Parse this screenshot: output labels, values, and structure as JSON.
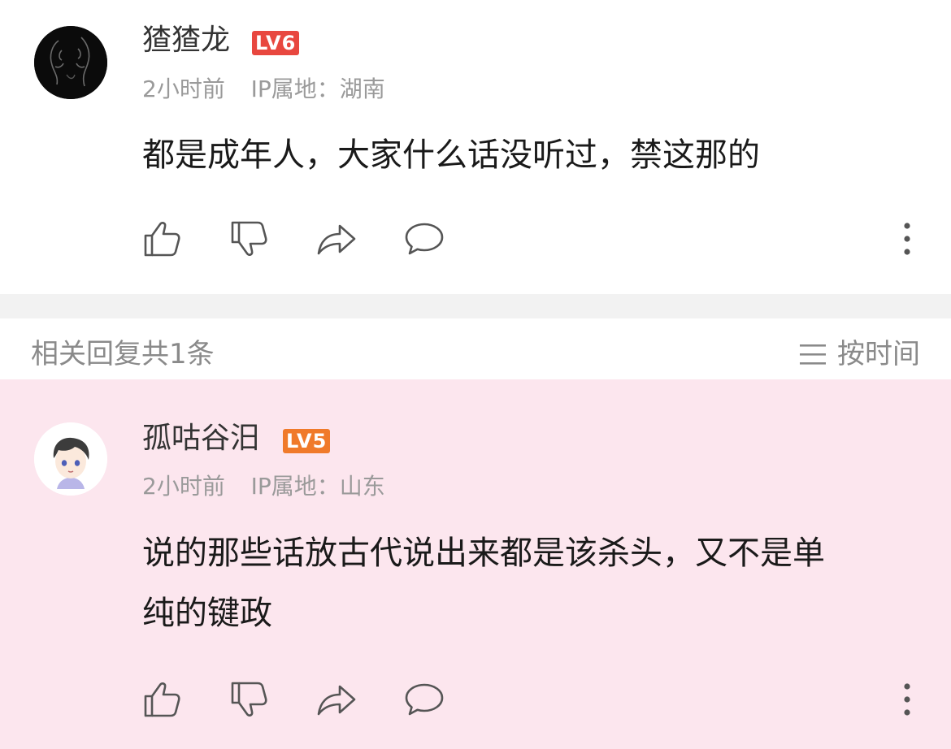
{
  "comment": {
    "username": "猹猹龙",
    "level": "LV6",
    "level_color": "#e8473f",
    "time": "2小时前",
    "ip_label": "IP属地：",
    "location": "湖南",
    "text": "都是成年人，大家什么话没听过，禁这那的",
    "avatar_icon": "dark-portrait-avatar",
    "actions": [
      "thumbs-up-icon",
      "thumbs-down-icon",
      "share-icon",
      "reply-bubble-icon",
      "more-vertical-icon"
    ]
  },
  "replies_header": {
    "count_text": "相关回复共1条",
    "sort_label": "按时间",
    "sort_icon": "menu-lines-icon"
  },
  "reply": {
    "username": "孤咕谷汨",
    "level": "LV5",
    "level_color": "#f07a2a",
    "time": "2小时前",
    "ip_label": "IP属地：",
    "location": "山东",
    "text_line1": "说的那些话放古代说出来都是该杀头，又不是单",
    "text_line2": "纯的键政",
    "avatar_icon": "cartoon-boy-avatar",
    "background": "#fce6ee"
  }
}
